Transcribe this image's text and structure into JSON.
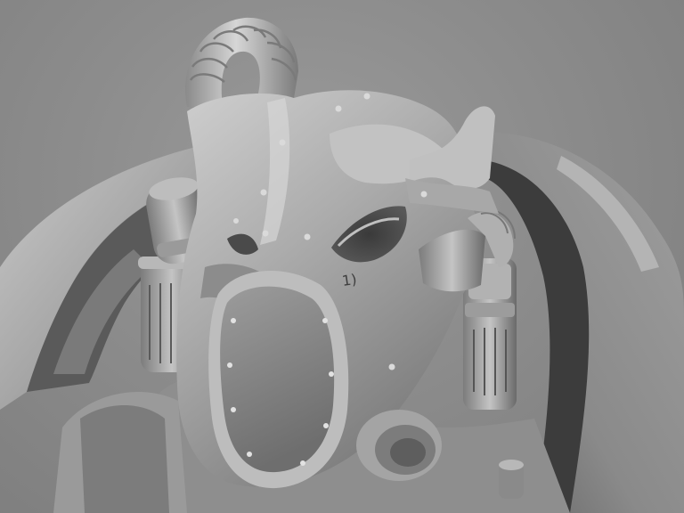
{
  "scene": {
    "subject": "armored-helmet-render",
    "render_style": "grey-clay",
    "colors": {
      "background": "#8a8a8a",
      "material_base": "#a9a9a9",
      "material_highlight": "#d2d2d2",
      "material_shadow": "#4e4e4e",
      "deep_shadow": "#2f2f2f"
    }
  },
  "decals": {
    "helmet_marking": "1)"
  }
}
